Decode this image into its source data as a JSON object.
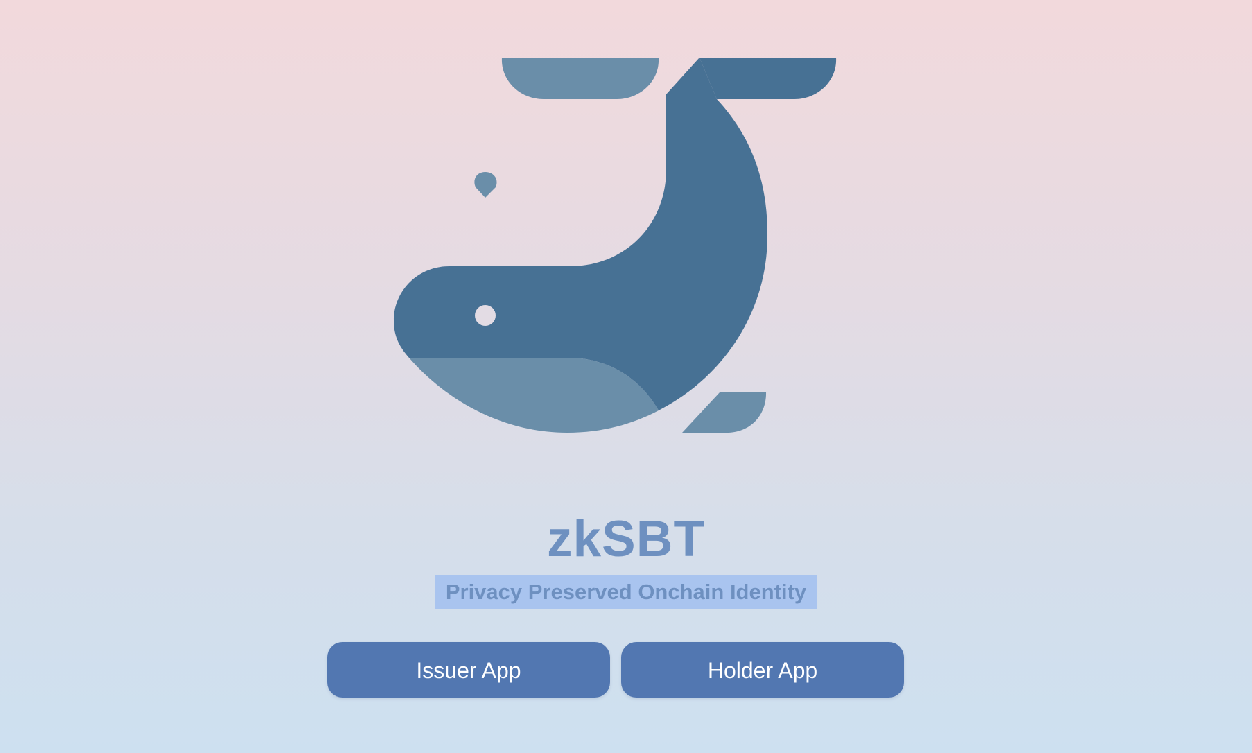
{
  "app": {
    "logo_icon": "whale-icon",
    "title": "zkSBT",
    "subtitle": "Privacy Preserved Onchain Identity"
  },
  "buttons": {
    "issuer_label": "Issuer App",
    "holder_label": "Holder App"
  },
  "colors": {
    "whale_dark": "#477194",
    "whale_light": "#6a8ea9",
    "title": "#6e90c0",
    "subtitle_highlight": "#a9c4ef",
    "button": "#5277b1",
    "bg_top": "#f2d9dc",
    "bg_bottom": "#cde0f0"
  }
}
